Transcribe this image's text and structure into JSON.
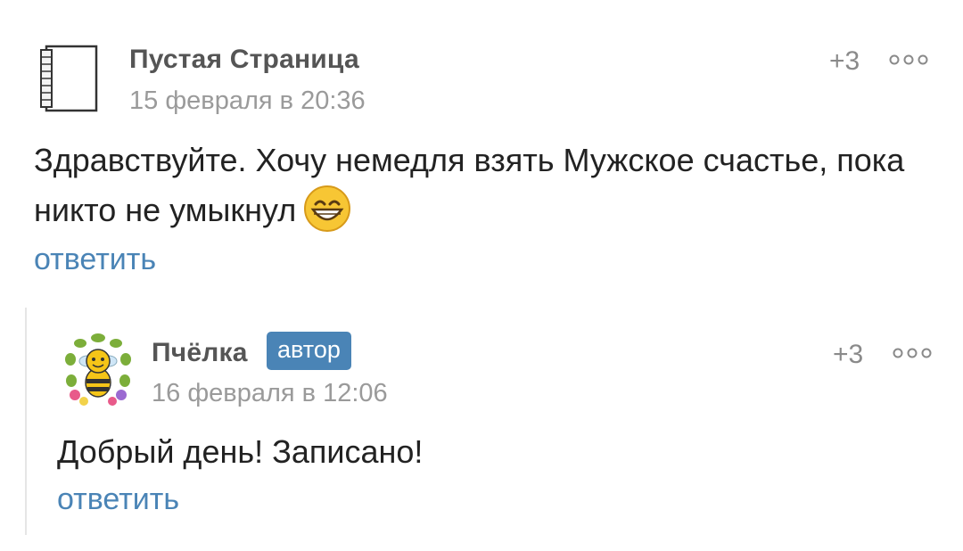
{
  "comments": [
    {
      "author": "Пустая Страница",
      "date": "15 февраля в 20:36",
      "score": "+3",
      "text": "Здравствуйте. Хочу немедля взять Мужское счастье, пока никто не умыкнул",
      "emoji_icon": "grinning-face-icon",
      "reply_label": "ответить",
      "avatar_icon": "notepad-icon"
    },
    {
      "author": "Пчёлка",
      "badge": "автор",
      "date": "16 февраля в 12:06",
      "score": "+3",
      "text": "Добрый день! Записано!",
      "reply_label": "ответить",
      "avatar_icon": "bee-flower-wreath-icon"
    }
  ],
  "colors": {
    "link": "#4a84b6",
    "badge_bg": "#4a84b6",
    "meta": "#9a9a9a",
    "author": "#555555"
  }
}
